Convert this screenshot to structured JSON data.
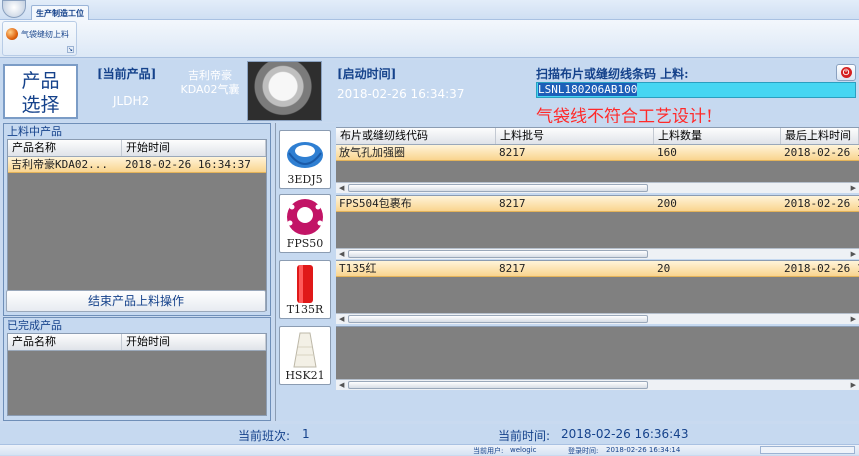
{
  "ribbon": {
    "tab_label": "生产制造工位",
    "button_label": "气袋缝纫上料",
    "launcher": "↘"
  },
  "header": {
    "product_button": [
      "产品",
      "选择"
    ],
    "current_product_label": "[当前产品]",
    "current_product_code": "JLDH2",
    "current_product_name": "吉利帝豪KDA02气囊",
    "start_time_label": "[启动时间]",
    "start_time_value": "2018-02-26 16:34:37",
    "scan_label": "扫描布片或缝纫线条码 上料:",
    "scan_value": "LSNL180206AB100",
    "error_message": "气袋线不符合工艺设计!"
  },
  "left_panel": {
    "loading_title": "上料中产品",
    "columns": [
      "产品名称",
      "开始时间"
    ],
    "loading_rows": [
      {
        "name": "吉利帝豪KDA02...",
        "time": "2018-02-26 16:34:37"
      }
    ],
    "end_button": "结束产品上料操作",
    "completed_title": "已完成产品",
    "completed_columns": [
      "产品名称",
      "开始时间"
    ]
  },
  "materials": {
    "columns": [
      "布片或缝纫线代码",
      "上料批号",
      "上料数量",
      "最后上料时间"
    ],
    "items": [
      {
        "caption": "3EDJ5",
        "icon": "blue-cushion-icon",
        "row": {
          "code": "放气孔加强圈",
          "batch": "8217",
          "qty": "160",
          "time": "2018-02-26 1"
        }
      },
      {
        "caption": "FPS50",
        "icon": "magenta-fabric-icon",
        "row": {
          "code": "FPS504包裹布",
          "batch": "8217",
          "qty": "200",
          "time": "2018-02-26 1"
        }
      },
      {
        "caption": "T135R",
        "icon": "red-thread-spool-icon",
        "row": {
          "code": "T135红",
          "batch": "8217",
          "qty": "20",
          "time": "2018-02-26 1"
        }
      },
      {
        "caption": "HSK21",
        "icon": "white-thread-spool-icon",
        "row": null
      }
    ]
  },
  "status": {
    "shift_label": "当前班次:",
    "shift_value": "1",
    "time_label": "当前时间:",
    "time_value": "2018-02-26 16:36:43",
    "user_label": "当前用户:",
    "user_value": "welogic",
    "login_label": "登录时间:",
    "login_value": "2018-02-26 16:34:14"
  },
  "colors": {
    "accent": "#15428b",
    "selected_row": "#f9d48f",
    "error": "#ff2a2a",
    "scan_field": "#46d6f2"
  }
}
